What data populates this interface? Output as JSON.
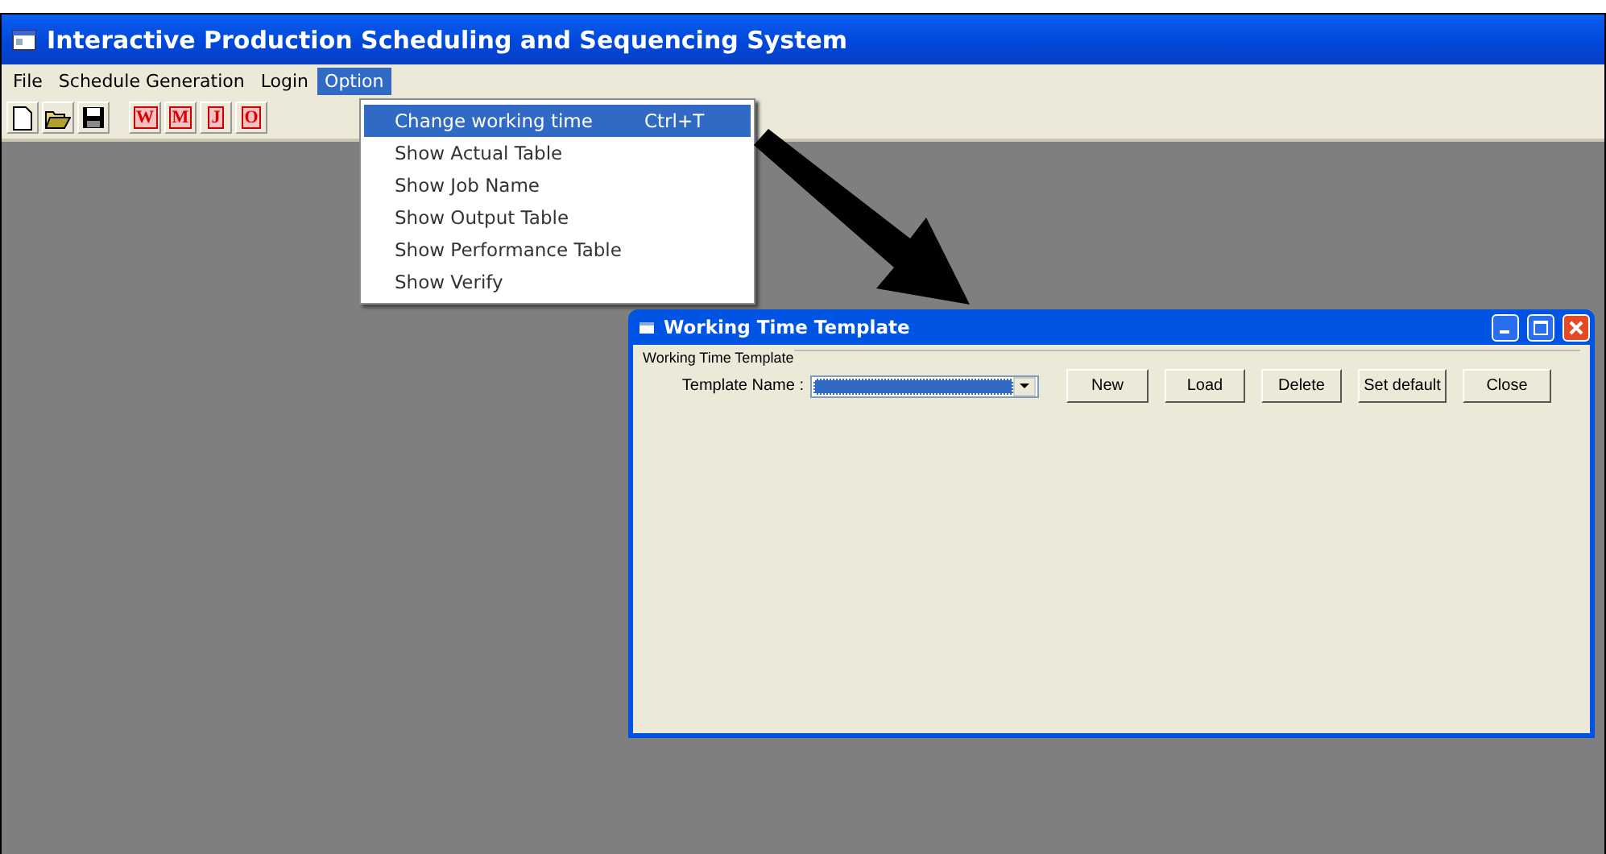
{
  "window": {
    "title": "Interactive Production Scheduling and Sequencing System"
  },
  "menu_bar": [
    {
      "label": "File",
      "selected": false
    },
    {
      "label": "Schedule Generation",
      "selected": false
    },
    {
      "label": "Login",
      "selected": false
    },
    {
      "label": "Option",
      "selected": true
    }
  ],
  "toolbar": [
    {
      "kind": "new"
    },
    {
      "kind": "open"
    },
    {
      "kind": "save"
    },
    {
      "kind": "letter",
      "label": "W"
    },
    {
      "kind": "letter",
      "label": "M"
    },
    {
      "kind": "letter",
      "label": "J"
    },
    {
      "kind": "letter",
      "label": "O"
    }
  ],
  "option_menu": [
    {
      "label": "Change working time",
      "shortcut": "Ctrl+T",
      "selected": true
    },
    {
      "label": "Show Actual Table",
      "selected": false
    },
    {
      "label": "Show Job Name",
      "selected": false
    },
    {
      "label": "Show Output Table",
      "selected": false
    },
    {
      "label": "Show Performance Table",
      "selected": false
    },
    {
      "label": "Show Verify",
      "selected": false
    }
  ],
  "dialog": {
    "title": "Working Time Template",
    "group_label": "Working Time Template",
    "field_label": "Template Name :",
    "buttons": [
      "New",
      "Load",
      "Delete",
      "Set default",
      "Close"
    ]
  }
}
